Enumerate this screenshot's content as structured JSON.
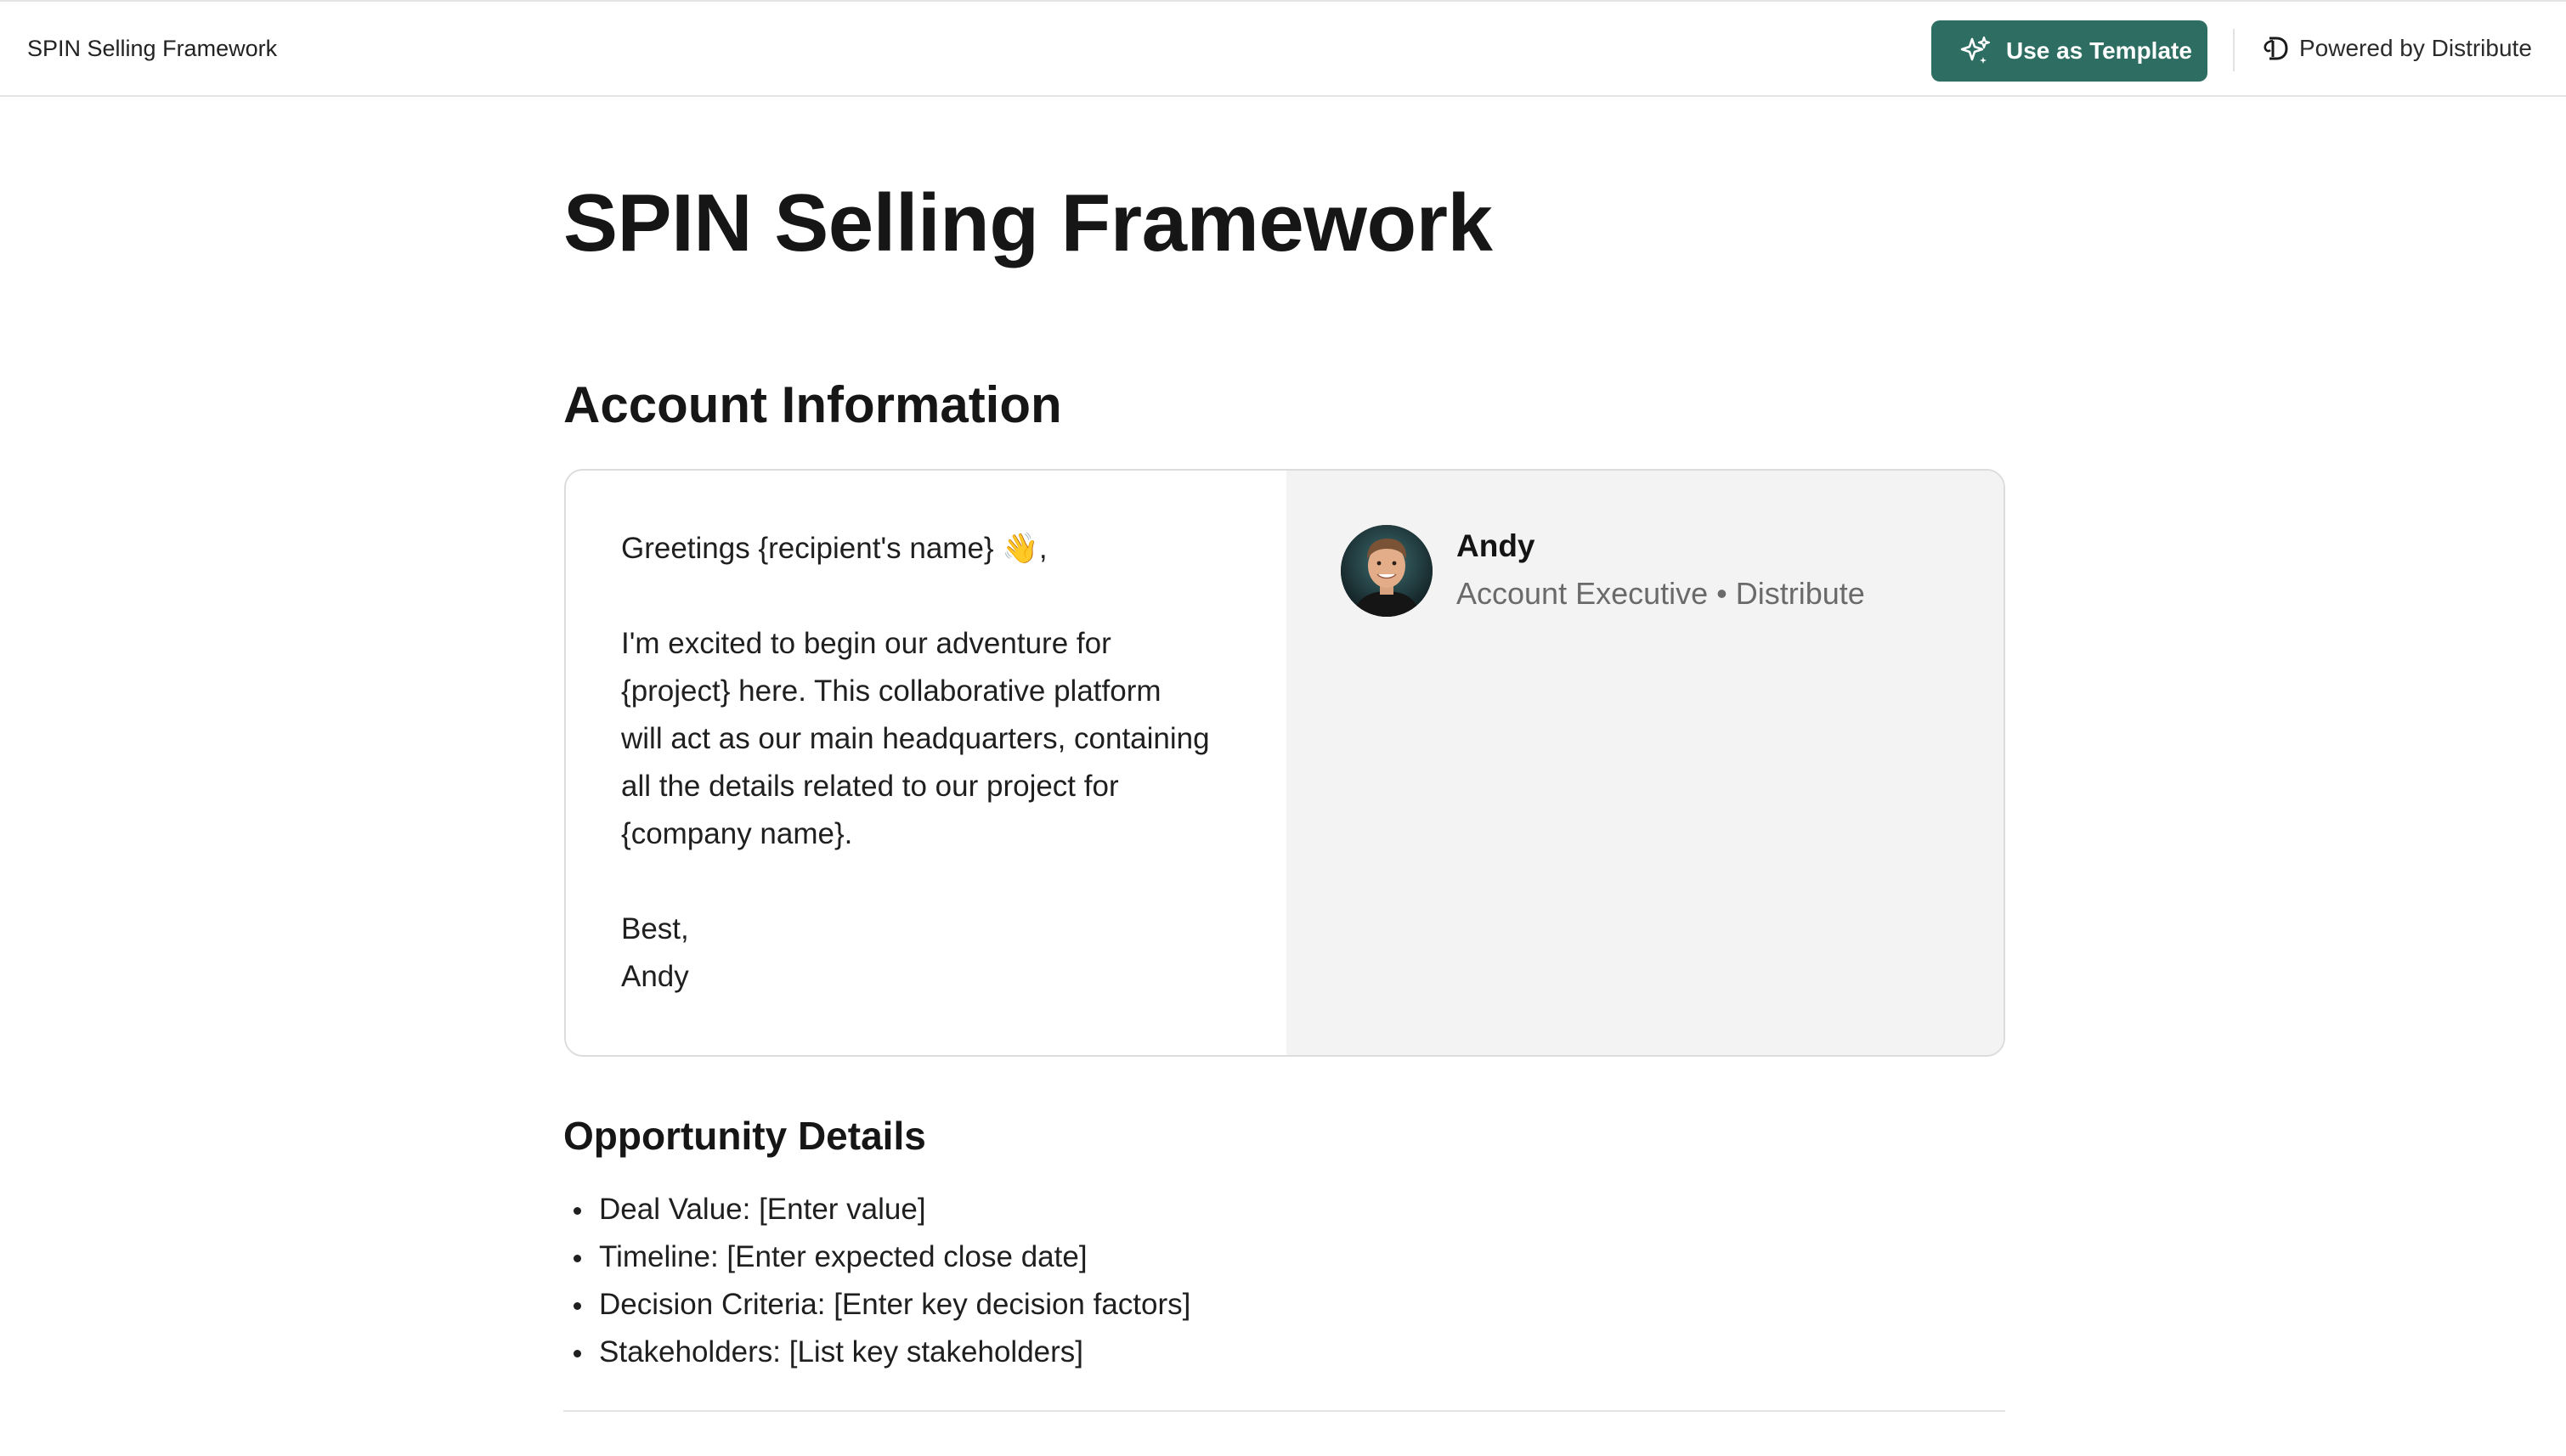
{
  "header": {
    "app_title": "SPIN Selling Framework",
    "template_button_label": "Use as Template",
    "template_button_icon": "sparkle-icon",
    "powered_label": "Powered by Distribute",
    "powered_icon": "distribute-logo-icon"
  },
  "page": {
    "title": "SPIN Selling Framework"
  },
  "account_information": {
    "heading": "Account Information",
    "message": {
      "greeting": "Greetings {recipient's name} 👋,",
      "body_lines": [
        "I'm excited to begin our adventure for",
        "{project} here. This collaborative platform",
        "will act as our main headquarters, containing",
        "all the details related to our project for",
        "{company name}."
      ],
      "signoff": "Best,",
      "signature": "Andy"
    },
    "sender": {
      "name": "Andy",
      "role": "Account Executive • Distribute"
    }
  },
  "opportunity_details": {
    "heading": "Opportunity Details",
    "items": [
      "Deal Value: [Enter value]",
      "Timeline: [Enter expected close date]",
      "Decision Criteria: [Enter key decision factors]",
      "Stakeholders: [List key stakeholders]"
    ]
  },
  "colors": {
    "accent": "#2e6e62",
    "sender_panel_bg": "#f3f3f3",
    "muted_text": "#6a6a6a"
  }
}
